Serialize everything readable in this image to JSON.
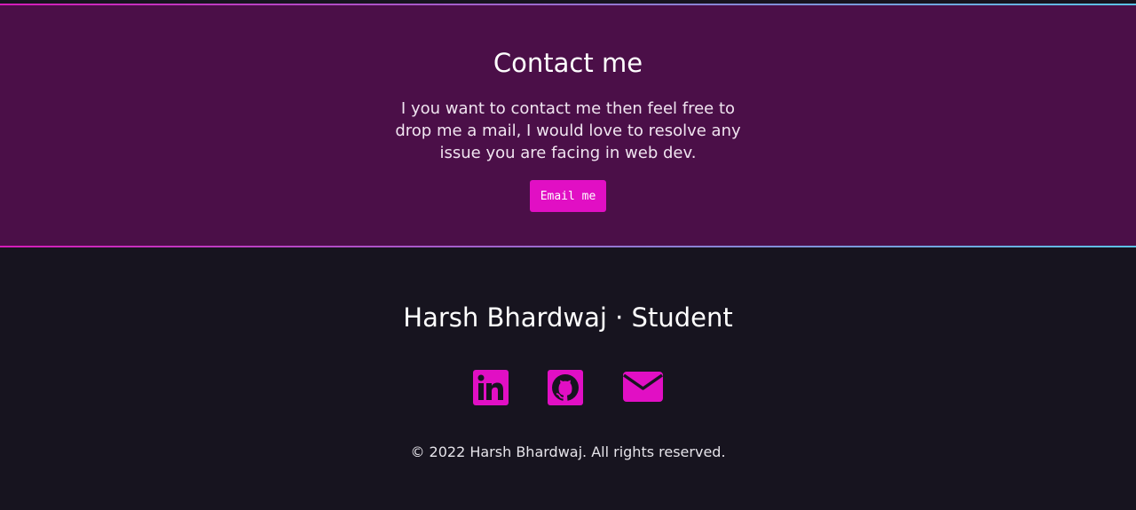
{
  "contact": {
    "title": "Contact me",
    "text": "I you want to contact me then feel free to drop me a mail, I would love to resolve any issue you are facing in web dev.",
    "button_label": "Email me"
  },
  "footer": {
    "title": "Harsh Bhardwaj · Student",
    "social_icons": [
      "linkedin-icon",
      "github-icon",
      "mail-icon"
    ],
    "copyright": "© 2022 Harsh Bhardwaj. All rights reserved."
  },
  "colors": {
    "accent": "#e10fc4",
    "contact_bg": "#4b0f48",
    "footer_bg": "#17141f",
    "divider_start": "#d61bb9",
    "divider_end": "#5bc3e6"
  }
}
